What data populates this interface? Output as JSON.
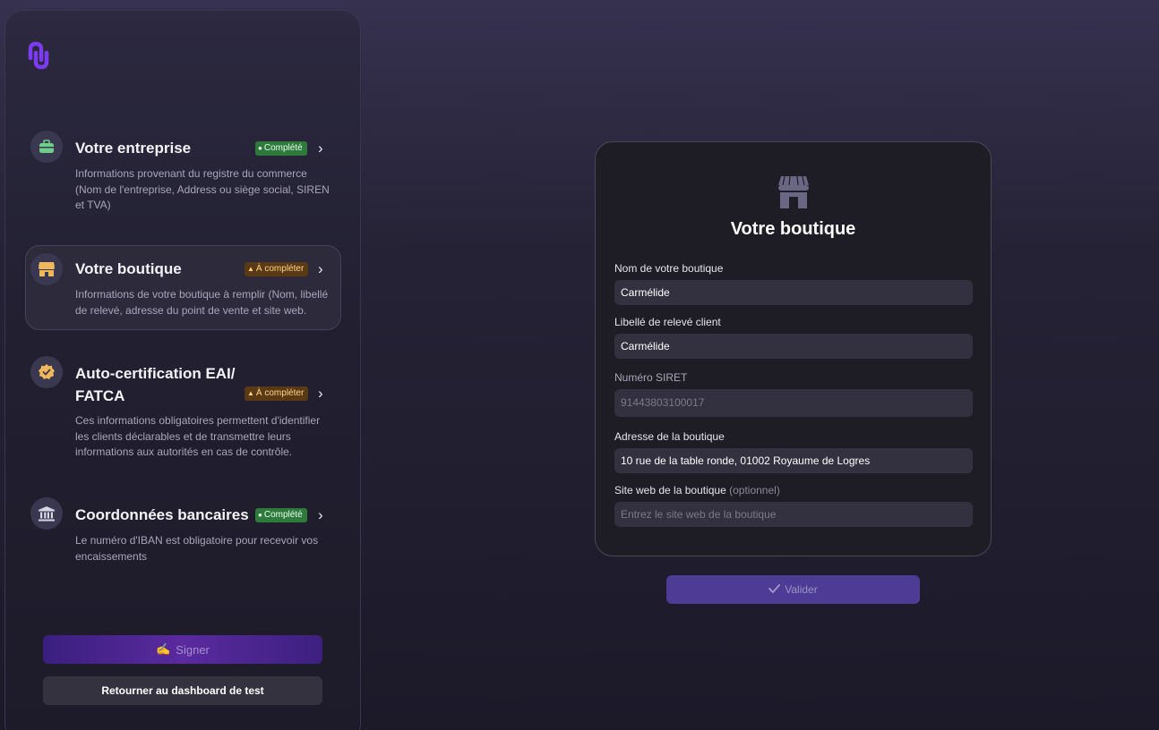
{
  "sidebar": {
    "steps": [
      {
        "title": "Votre entreprise",
        "badge": "Complété",
        "status": "done",
        "icon": "briefcase-icon",
        "description": "Informations provenant du registre du commerce (Nom de l'entreprise, Address ou siège social, SIREN et TVA)"
      },
      {
        "title": "Votre boutique",
        "badge": "À compléter",
        "status": "todo",
        "icon": "shop-icon",
        "description": "Informations de votre boutique à remplir (Nom, libellé de relevé, adresse du point de vente et site web."
      },
      {
        "title": "Auto-certification EAI/ FATCA",
        "badge": "À compléter",
        "status": "todo",
        "icon": "certified-badge-icon",
        "description": "Ces informations obligatoires permettent d'identifier les clients déclarables et de transmettre leurs informations aux autorités en cas de contrôle."
      },
      {
        "title": "Coordonnées bancaires",
        "badge": "Complété",
        "status": "done",
        "icon": "bank-icon",
        "description": "Le numéro d'IBAN est obligatoire pour recevoir vos encaissements"
      }
    ],
    "sign_label": "Signer",
    "back_label": "Retourner au dashboard de test"
  },
  "form": {
    "title": "Votre boutique",
    "fields": [
      {
        "label": "Nom de votre boutique",
        "value": "Carmélide"
      },
      {
        "label": "Libellé de relevé client",
        "value": "Carmélide"
      },
      {
        "label": "Numéro SIRET",
        "value": "91443803100017"
      },
      {
        "label": "Adresse de la boutique",
        "value": "10 rue de la table ronde, 01002 Royaume de Logres"
      },
      {
        "label": "Site web de la boutique",
        "optional": "(optionnel)",
        "placeholder": "Entrez le site web de la boutique"
      }
    ],
    "submit_label": "Valider"
  },
  "colors": {
    "accent": "#4d3b95",
    "done_badge": "#2e7a3d",
    "todo_badge": "#5a3a14",
    "logo": "#7b3cf0"
  }
}
